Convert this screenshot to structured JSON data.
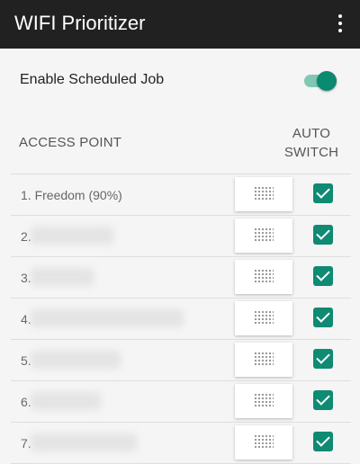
{
  "app_bar": {
    "title": "WIFI Prioritizer",
    "menu_icon": "more-vert-icon"
  },
  "schedule": {
    "label": "Enable Scheduled Job",
    "enabled": true
  },
  "table": {
    "col_access_point": "ACCESS POINT",
    "col_auto_line1": "AUTO",
    "col_auto_line2": "SWITCH",
    "rows": [
      {
        "label": "1. Freedom (90%)",
        "auto_switch": true
      },
      {
        "label": "2.",
        "auto_switch": true
      },
      {
        "label": "3.",
        "auto_switch": true
      },
      {
        "label": "4.",
        "auto_switch": true
      },
      {
        "label": "5.",
        "auto_switch": true
      },
      {
        "label": "6.",
        "auto_switch": true
      },
      {
        "label": "7.",
        "auto_switch": true
      }
    ]
  },
  "colors": {
    "accent": "#0f8a73",
    "app_bar": "#212121",
    "toggle_track": "#80c7b4"
  }
}
